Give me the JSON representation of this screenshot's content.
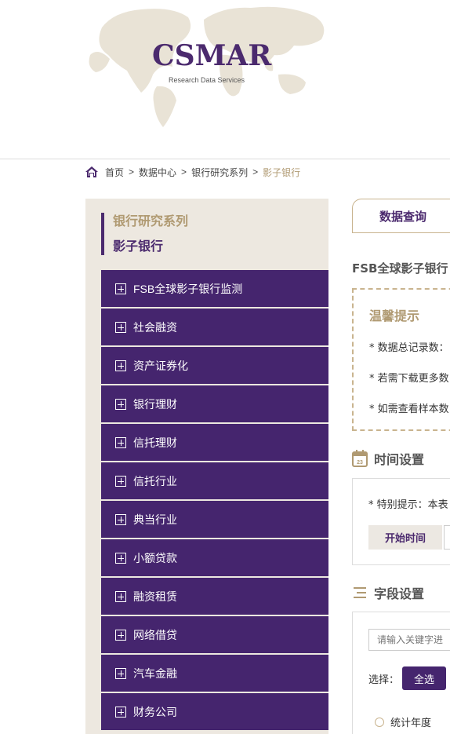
{
  "header": {
    "logo_text": "CSMAR",
    "logo_subtitle": "Research Data Services"
  },
  "breadcrumb": {
    "items": [
      "首页",
      "数据中心",
      "银行研究系列",
      "影子银行"
    ],
    "separator": ">"
  },
  "sidebar": {
    "title": "银行研究系列",
    "subtitle": "影子银行",
    "items": [
      {
        "label": "FSB全球影子银行监测"
      },
      {
        "label": "社会融资"
      },
      {
        "label": "资产证券化"
      },
      {
        "label": "银行理财"
      },
      {
        "label": "信托理财"
      },
      {
        "label": "信托行业"
      },
      {
        "label": "典当行业"
      },
      {
        "label": "小额贷款"
      },
      {
        "label": "融资租赁"
      },
      {
        "label": "网络借贷"
      },
      {
        "label": "汽车金融"
      },
      {
        "label": "财务公司"
      }
    ]
  },
  "main": {
    "tab_label": "数据查询",
    "query_title": "FSB全球影子银行",
    "tips": {
      "title": "温馨提示",
      "lines": [
        "* 数据总记录数：",
        "* 若需下载更多数",
        "* 如需查看样本数"
      ]
    },
    "time_section": {
      "title": "时间设置",
      "note": "* 特别提示：本表",
      "start_label": "开始时间"
    },
    "field_section": {
      "title": "字段设置",
      "search_placeholder": "请输入关键字进",
      "select_label": "选择：",
      "select_all_label": "全选",
      "first_field": "统计年度"
    }
  },
  "colors": {
    "brand_purple": "#45256e",
    "accent_tan": "#b09a72",
    "sidebar_bg": "#ede8e0"
  }
}
